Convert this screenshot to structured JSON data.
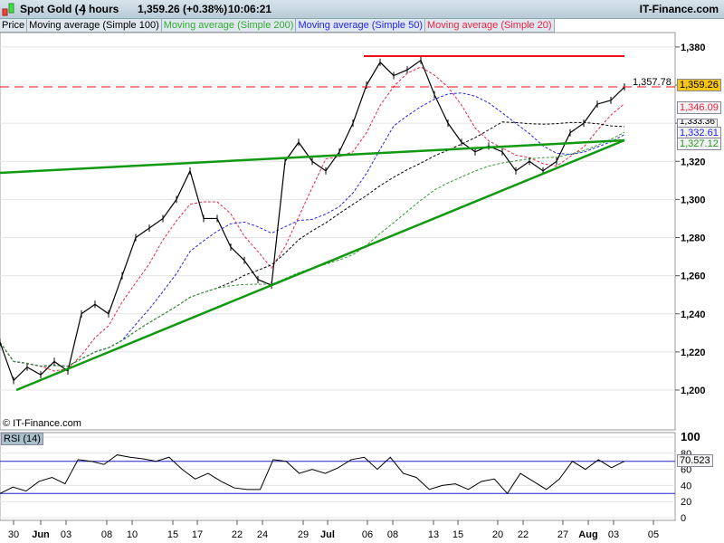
{
  "header": {
    "instrument": "Spot Gold (-)",
    "interval": "4 hours",
    "price": "1,359.26 (+0.38%)",
    "time": "10:06:21",
    "brand": "IT-Finance.com"
  },
  "legend": [
    "Price",
    "Moving average (Simple 100)",
    "Moving average (Simple 200)",
    "Moving average (Simple 50)",
    "Moving average (Simple 20)"
  ],
  "colors": {
    "price": "#000000",
    "ma100": "#000000",
    "ma200": "#339933",
    "ma50": "#2222ee",
    "ma20": "#ee2244",
    "trend": "#119911",
    "resistance": "#ee1111"
  },
  "watermark": "© IT-Finance.com",
  "rsi_label": "RSI (14)",
  "chart_data": {
    "type": "line",
    "title": "Spot Gold (-) 4 hours",
    "price_axis": {
      "ticks": [
        "1,200",
        "1,220",
        "1,240",
        "1,260",
        "1,280",
        "1,300",
        "1,320",
        "1,340",
        "1,360",
        "1,380"
      ],
      "range": [
        1185,
        1387
      ]
    },
    "x_ticks": [
      "30",
      "Jun",
      "03",
      "08",
      "10",
      "15",
      "17",
      "22",
      "24",
      "29",
      "Jul",
      "06",
      "08",
      "13",
      "15",
      "20",
      "22",
      "27",
      "Aug",
      "03",
      "05"
    ],
    "price": [
      1225,
      1205,
      1212,
      1208,
      1215,
      1210,
      1240,
      1245,
      1240,
      1260,
      1280,
      1285,
      1290,
      1300,
      1315,
      1290,
      1290,
      1275,
      1268,
      1258,
      1255,
      1320,
      1330,
      1320,
      1315,
      1325,
      1340,
      1360,
      1372,
      1365,
      1368,
      1373,
      1355,
      1340,
      1330,
      1325,
      1328,
      1325,
      1315,
      1320,
      1315,
      1320,
      1335,
      1340,
      1350,
      1352,
      1359
    ],
    "labels": {
      "last_close": "1,357.78",
      "price": "1,359.26",
      "ma20": "1,346.09",
      "ma100": "1,333.36",
      "ma50": "1,332.61",
      "ma200": "1,327.12",
      "rsi": "70.523"
    },
    "rsi": {
      "ticks": [
        "100",
        "80",
        "60",
        "40",
        "20",
        "0"
      ],
      "levels": [
        70,
        30
      ],
      "values": [
        30,
        38,
        33,
        45,
        50,
        42,
        72,
        70,
        66,
        78,
        75,
        73,
        70,
        75,
        60,
        48,
        55,
        45,
        37,
        35,
        35,
        72,
        70,
        55,
        60,
        55,
        62,
        72,
        75,
        60,
        75,
        55,
        50,
        35,
        40,
        42,
        35,
        45,
        48,
        30,
        55,
        45,
        35,
        48,
        70,
        60,
        72,
        62,
        70
      ]
    }
  }
}
